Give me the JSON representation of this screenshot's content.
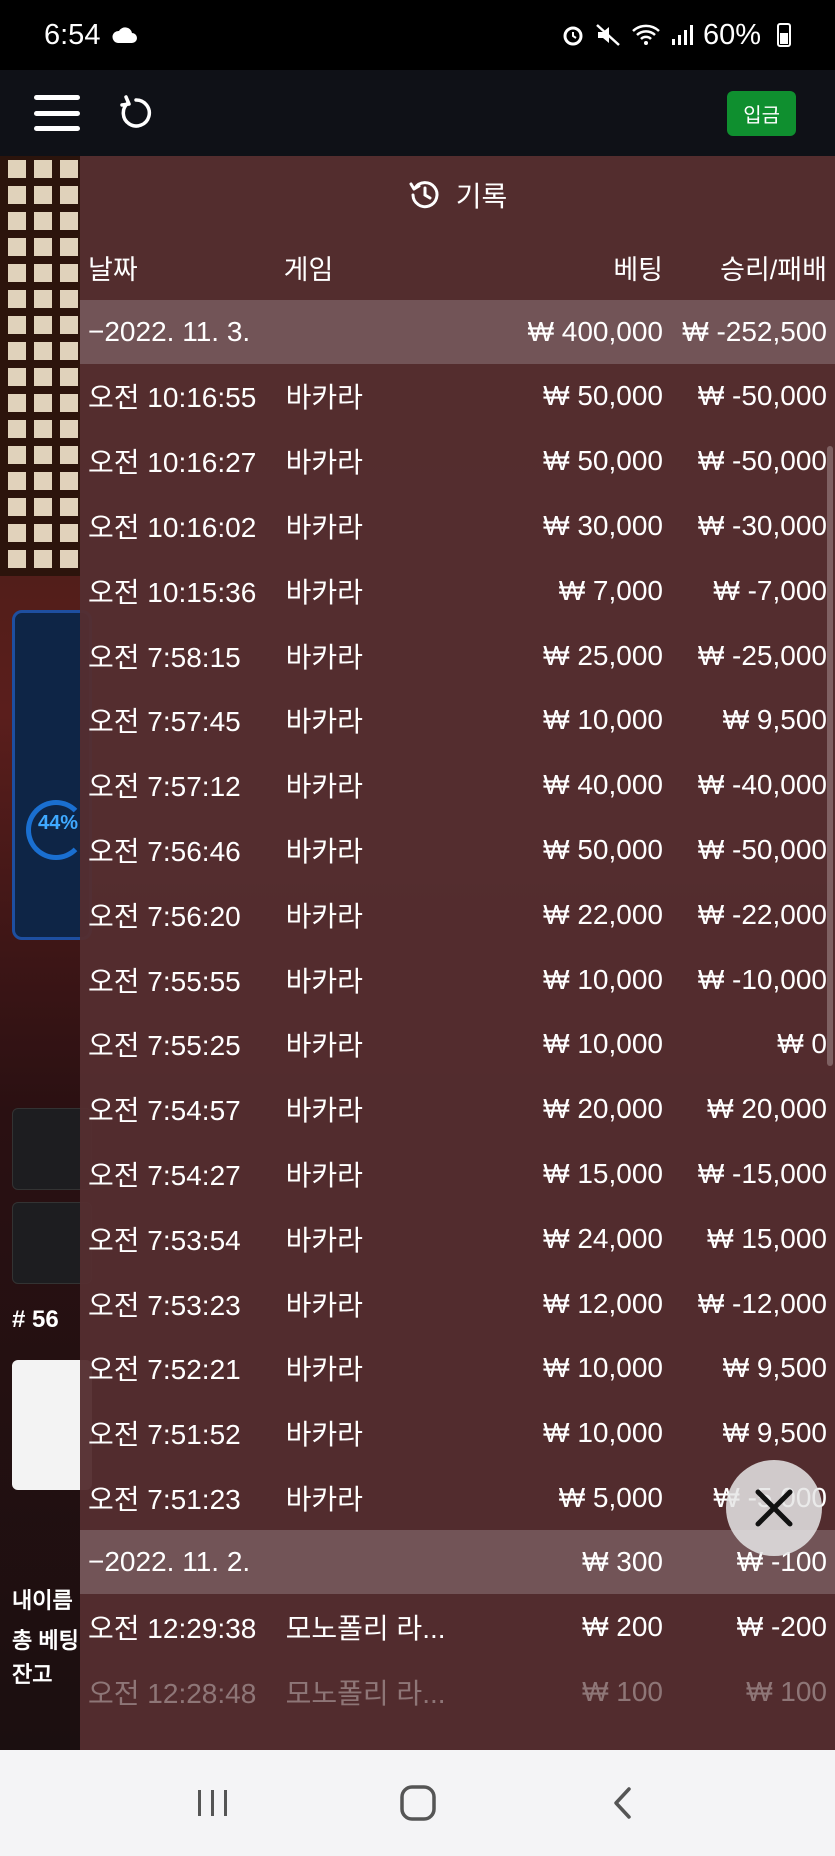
{
  "status_bar": {
    "time": "6:54",
    "battery": "60%"
  },
  "app_bar": {
    "deposit_label": "입금"
  },
  "background": {
    "panel_percent": "44%",
    "round": "# 56",
    "line1": "내이름",
    "line2": "총 베팅",
    "line3": "잔고"
  },
  "history": {
    "title": "기록",
    "columns": {
      "date": "날짜",
      "game": "게임",
      "bet": "베팅",
      "win": "승리/패배"
    },
    "groups": [
      {
        "date": "−2022. 11. 3.",
        "total_bet": "₩ 400,000",
        "total_win": "₩ -252,500",
        "rows": [
          {
            "time": "오전 10:16:55",
            "game": "바카라",
            "bet": "₩ 50,000",
            "win": "₩ -50,000"
          },
          {
            "time": "오전 10:16:27",
            "game": "바카라",
            "bet": "₩ 50,000",
            "win": "₩ -50,000"
          },
          {
            "time": "오전 10:16:02",
            "game": "바카라",
            "bet": "₩ 30,000",
            "win": "₩ -30,000"
          },
          {
            "time": "오전 10:15:36",
            "game": "바카라",
            "bet": "₩ 7,000",
            "win": "₩ -7,000"
          },
          {
            "time": "오전 7:58:15",
            "game": "바카라",
            "bet": "₩ 25,000",
            "win": "₩ -25,000"
          },
          {
            "time": "오전 7:57:45",
            "game": "바카라",
            "bet": "₩ 10,000",
            "win": "₩ 9,500"
          },
          {
            "time": "오전 7:57:12",
            "game": "바카라",
            "bet": "₩ 40,000",
            "win": "₩ -40,000"
          },
          {
            "time": "오전 7:56:46",
            "game": "바카라",
            "bet": "₩ 50,000",
            "win": "₩ -50,000"
          },
          {
            "time": "오전 7:56:20",
            "game": "바카라",
            "bet": "₩ 22,000",
            "win": "₩ -22,000"
          },
          {
            "time": "오전 7:55:55",
            "game": "바카라",
            "bet": "₩ 10,000",
            "win": "₩ -10,000"
          },
          {
            "time": "오전 7:55:25",
            "game": "바카라",
            "bet": "₩ 10,000",
            "win": "₩ 0"
          },
          {
            "time": "오전 7:54:57",
            "game": "바카라",
            "bet": "₩ 20,000",
            "win": "₩ 20,000"
          },
          {
            "time": "오전 7:54:27",
            "game": "바카라",
            "bet": "₩ 15,000",
            "win": "₩ -15,000"
          },
          {
            "time": "오전 7:53:54",
            "game": "바카라",
            "bet": "₩ 24,000",
            "win": "₩ 15,000"
          },
          {
            "time": "오전 7:53:23",
            "game": "바카라",
            "bet": "₩ 12,000",
            "win": "₩ -12,000"
          },
          {
            "time": "오전 7:52:21",
            "game": "바카라",
            "bet": "₩ 10,000",
            "win": "₩ 9,500"
          },
          {
            "time": "오전 7:51:52",
            "game": "바카라",
            "bet": "₩ 10,000",
            "win": "₩ 9,500"
          },
          {
            "time": "오전 7:51:23",
            "game": "바카라",
            "bet": "₩ 5,000",
            "win": "₩ -5,000"
          }
        ]
      },
      {
        "date": "−2022. 11. 2.",
        "total_bet": "₩ 300",
        "total_win": "₩ -100",
        "rows": [
          {
            "time": "오전 12:29:38",
            "game": "모노폴리 라...",
            "bet": "₩ 200",
            "win": "₩ -200"
          },
          {
            "time": "오전 12:28:48",
            "game": "모노폴리 라...",
            "bet": "₩ 100",
            "win": "₩ 100"
          }
        ]
      }
    ]
  }
}
